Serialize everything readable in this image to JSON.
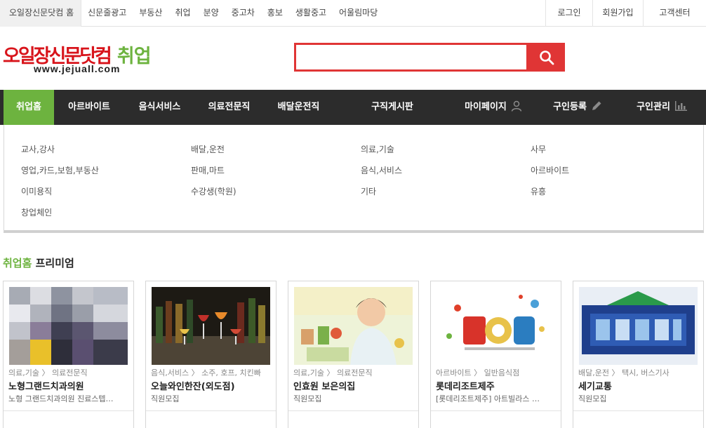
{
  "topnav": {
    "items": [
      "오일장신문닷컴 홈",
      "신문줄광고",
      "부동산",
      "취업",
      "분양",
      "중고차",
      "홍보",
      "생활중고",
      "어울림마당"
    ]
  },
  "toplinks": [
    "로그인",
    "회원가입",
    "고객센터"
  ],
  "logo": {
    "brand": "오일장신문닷컴",
    "section": "취업",
    "url": "www.jejuall.com"
  },
  "search": {
    "value": "",
    "placeholder": ""
  },
  "mainnav": {
    "items": [
      "취업홈",
      "아르바이트",
      "음식서비스",
      "의료전문직",
      "배달운전직",
      "구직게시판",
      "마이페이지",
      "구인등록",
      "구인관리"
    ],
    "active": "취업홈",
    "accent": "#6db33f",
    "background": "#2c2c2c"
  },
  "categories": [
    [
      "교사,강사",
      "배달,운전",
      "의료,기술",
      "사무"
    ],
    [
      "영업,카드,보험,부동산",
      "판매,마트",
      "음식,서비스",
      "아르바이트"
    ],
    [
      "이미용직",
      "수강생(학원)",
      "기타",
      "유흥"
    ],
    [
      "창업체인"
    ]
  ],
  "premium": {
    "title_green": "취업홈",
    "title_rest": " 프리미엄",
    "cards": [
      {
        "category": "의료,기술 〉 의료전문직",
        "title": "노형그랜드치과의원",
        "desc": "노형 그랜드치과의원 진료스텝…",
        "image": "pixelated-photo"
      },
      {
        "category": "음식,서비스 〉 소주, 호프, 치킨빠",
        "title": "오늘와인한잔(외도점)",
        "desc": "직원모집",
        "image": "wine-glasses-photo"
      },
      {
        "category": "의료,기술 〉 의료전문직",
        "title": "인효원 보은의집",
        "desc": "직원모집",
        "image": "caregiver-photo"
      },
      {
        "category": "아르바이트 〉 일반음식점",
        "title": "롯데리조트제주",
        "desc": "[롯데리조트제주] 아트빌라스 …",
        "image": "job-logo"
      },
      {
        "category": "배달,운전 〉 택시, 버스기사",
        "title": "세기교통",
        "desc": "직원모집",
        "image": "company-logo"
      }
    ]
  },
  "colors": {
    "accent_green": "#6db33f",
    "search_red": "#e03535",
    "brand_red": "#d8141b"
  }
}
